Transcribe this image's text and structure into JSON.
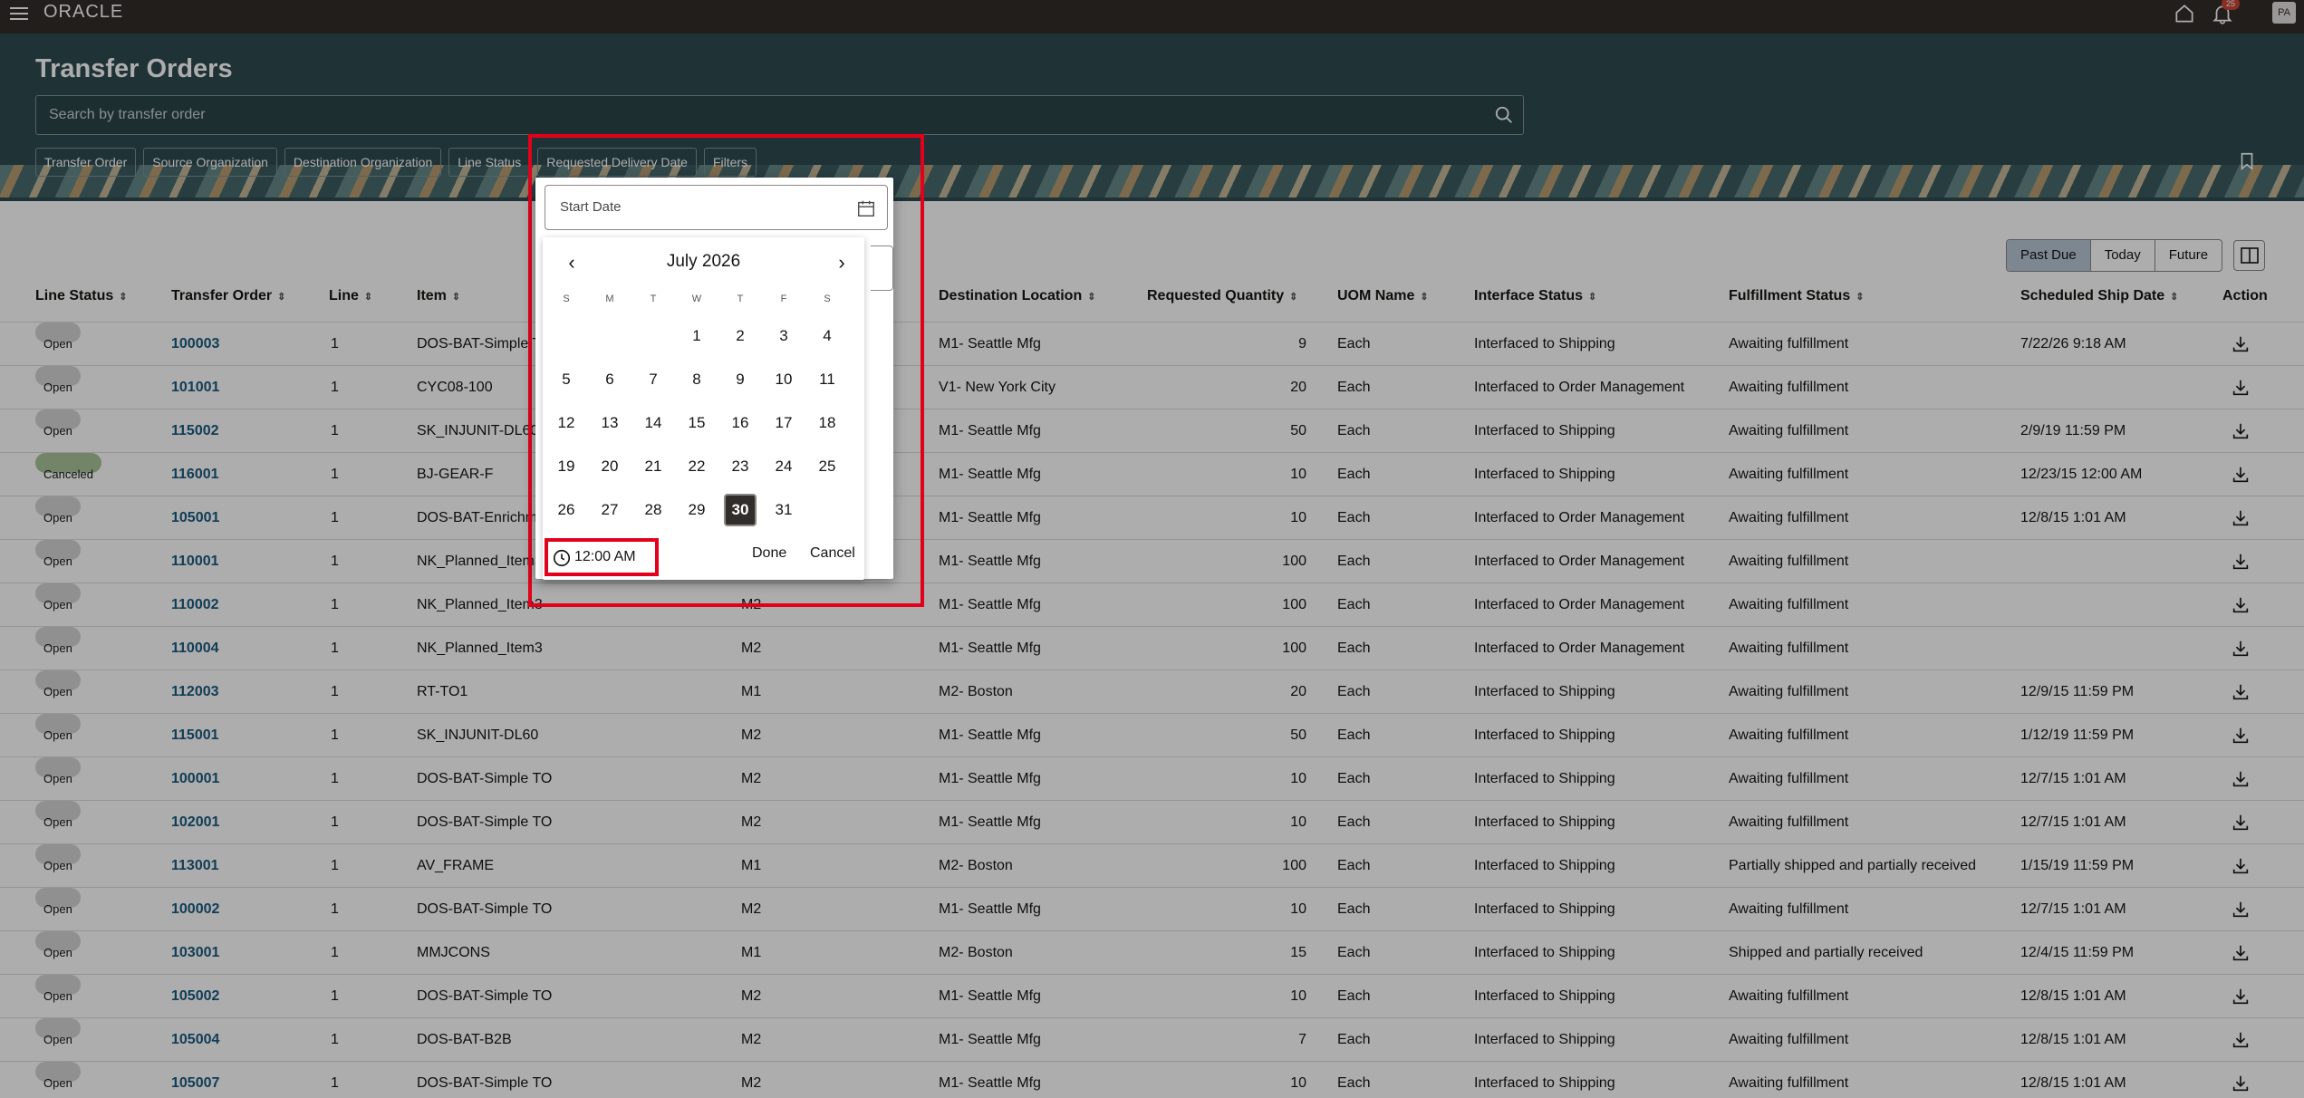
{
  "topbar": {
    "brand": "ORACLE",
    "notification_count": "25",
    "user_initials": "PA"
  },
  "header": {
    "title": "Transfer Orders",
    "search_placeholder": "Search by transfer order",
    "filter_chips": [
      "Transfer Order",
      "Source Organization",
      "Destination Organization",
      "Line Status",
      "Requested Delivery Date",
      "Filters"
    ]
  },
  "toolbar": {
    "segments": [
      "Past Due",
      "Today",
      "Future"
    ],
    "selected_segment": "Past Due"
  },
  "table": {
    "headers": {
      "line_status": "Line Status",
      "transfer_order": "Transfer Order",
      "line": "Line",
      "item": "Item",
      "destination_location": "Destination Location",
      "requested_quantity": "Requested Quantity",
      "uom_name": "UOM Name",
      "interface_status": "Interface Status",
      "fulfillment_status": "Fulfillment Status",
      "scheduled_ship_date": "Scheduled Ship Date",
      "action": "Action"
    },
    "rows": [
      {
        "status": "Open",
        "order": "100003",
        "line": "1",
        "item": "DOS-BAT-Simple TO",
        "org": "",
        "dest": "M1- Seattle Mfg",
        "qty": "9",
        "uom": "Each",
        "interface": "Interfaced to Shipping",
        "fulfillment": "Awaiting fulfillment",
        "ship": "7/22/26 9:18 AM"
      },
      {
        "status": "Open",
        "order": "101001",
        "line": "1",
        "item": "CYC08-100",
        "org": "",
        "dest": "V1- New York City",
        "qty": "20",
        "uom": "Each",
        "interface": "Interfaced to Order Management",
        "fulfillment": "Awaiting fulfillment",
        "ship": ""
      },
      {
        "status": "Open",
        "order": "115002",
        "line": "1",
        "item": "SK_INJUNIT-DL60",
        "org": "",
        "dest": "M1- Seattle Mfg",
        "qty": "50",
        "uom": "Each",
        "interface": "Interfaced to Shipping",
        "fulfillment": "Awaiting fulfillment",
        "ship": "2/9/19 11:59 PM"
      },
      {
        "status": "Canceled",
        "order": "116001",
        "line": "1",
        "item": "BJ-GEAR-F",
        "org": "",
        "dest": "M1- Seattle Mfg",
        "qty": "10",
        "uom": "Each",
        "interface": "Interfaced to Shipping",
        "fulfillment": "Awaiting fulfillment",
        "ship": "12/23/15 12:00 AM"
      },
      {
        "status": "Open",
        "order": "105001",
        "line": "1",
        "item": "DOS-BAT-Enrichment",
        "org": "",
        "dest": "M1- Seattle Mfg",
        "qty": "10",
        "uom": "Each",
        "interface": "Interfaced to Order Management",
        "fulfillment": "Awaiting fulfillment",
        "ship": "12/8/15 1:01 AM"
      },
      {
        "status": "Open",
        "order": "110001",
        "line": "1",
        "item": "NK_Planned_Item3",
        "org": "",
        "dest": "M1- Seattle Mfg",
        "qty": "100",
        "uom": "Each",
        "interface": "Interfaced to Order Management",
        "fulfillment": "Awaiting fulfillment",
        "ship": ""
      },
      {
        "status": "Open",
        "order": "110002",
        "line": "1",
        "item": "NK_Planned_Item3",
        "org": "M2",
        "dest": "M1- Seattle Mfg",
        "qty": "100",
        "uom": "Each",
        "interface": "Interfaced to Order Management",
        "fulfillment": "Awaiting fulfillment",
        "ship": ""
      },
      {
        "status": "Open",
        "order": "110004",
        "line": "1",
        "item": "NK_Planned_Item3",
        "org": "M2",
        "dest": "M1- Seattle Mfg",
        "qty": "100",
        "uom": "Each",
        "interface": "Interfaced to Order Management",
        "fulfillment": "Awaiting fulfillment",
        "ship": ""
      },
      {
        "status": "Open",
        "order": "112003",
        "line": "1",
        "item": "RT-TO1",
        "org": "M1",
        "dest": "M2- Boston",
        "qty": "20",
        "uom": "Each",
        "interface": "Interfaced to Shipping",
        "fulfillment": "Awaiting fulfillment",
        "ship": "12/9/15 11:59 PM"
      },
      {
        "status": "Open",
        "order": "115001",
        "line": "1",
        "item": "SK_INJUNIT-DL60",
        "org": "M2",
        "dest": "M1- Seattle Mfg",
        "qty": "50",
        "uom": "Each",
        "interface": "Interfaced to Shipping",
        "fulfillment": "Awaiting fulfillment",
        "ship": "1/12/19 11:59 PM"
      },
      {
        "status": "Open",
        "order": "100001",
        "line": "1",
        "item": "DOS-BAT-Simple TO",
        "org": "M2",
        "dest": "M1- Seattle Mfg",
        "qty": "10",
        "uom": "Each",
        "interface": "Interfaced to Shipping",
        "fulfillment": "Awaiting fulfillment",
        "ship": "12/7/15 1:01 AM"
      },
      {
        "status": "Open",
        "order": "102001",
        "line": "1",
        "item": "DOS-BAT-Simple TO",
        "org": "M2",
        "dest": "M1- Seattle Mfg",
        "qty": "10",
        "uom": "Each",
        "interface": "Interfaced to Shipping",
        "fulfillment": "Awaiting fulfillment",
        "ship": "12/7/15 1:01 AM"
      },
      {
        "status": "Open",
        "order": "113001",
        "line": "1",
        "item": "AV_FRAME",
        "org": "M1",
        "dest": "M2- Boston",
        "qty": "100",
        "uom": "Each",
        "interface": "Interfaced to Shipping",
        "fulfillment": "Partially shipped and partially received",
        "ship": "1/15/19 11:59 PM"
      },
      {
        "status": "Open",
        "order": "100002",
        "line": "1",
        "item": "DOS-BAT-Simple TO",
        "org": "M2",
        "dest": "M1- Seattle Mfg",
        "qty": "10",
        "uom": "Each",
        "interface": "Interfaced to Shipping",
        "fulfillment": "Awaiting fulfillment",
        "ship": "12/7/15 1:01 AM"
      },
      {
        "status": "Open",
        "order": "103001",
        "line": "1",
        "item": "MMJCONS",
        "org": "M1",
        "dest": "M2- Boston",
        "qty": "15",
        "uom": "Each",
        "interface": "Interfaced to Shipping",
        "fulfillment": "Shipped and partially received",
        "ship": "12/4/15 11:59 PM"
      },
      {
        "status": "Open",
        "order": "105002",
        "line": "1",
        "item": "DOS-BAT-Simple TO",
        "org": "M2",
        "dest": "M1- Seattle Mfg",
        "qty": "10",
        "uom": "Each",
        "interface": "Interfaced to Shipping",
        "fulfillment": "Awaiting fulfillment",
        "ship": "12/8/15 1:01 AM"
      },
      {
        "status": "Open",
        "order": "105004",
        "line": "1",
        "item": "DOS-BAT-B2B",
        "org": "M2",
        "dest": "M1- Seattle Mfg",
        "qty": "7",
        "uom": "Each",
        "interface": "Interfaced to Shipping",
        "fulfillment": "Awaiting fulfillment",
        "ship": "12/8/15 1:01 AM"
      },
      {
        "status": "Open",
        "order": "105007",
        "line": "1",
        "item": "DOS-BAT-Simple TO",
        "org": "M2",
        "dest": "M1- Seattle Mfg",
        "qty": "10",
        "uom": "Each",
        "interface": "Interfaced to Shipping",
        "fulfillment": "Awaiting fulfillment",
        "ship": "12/8/15 1:01 AM"
      }
    ]
  },
  "datepicker": {
    "start_label": "Start Date",
    "month_label": "July 2026",
    "weekdays": [
      "S",
      "M",
      "T",
      "W",
      "T",
      "F",
      "S"
    ],
    "first_weekday_index": 3,
    "days_in_month": 31,
    "selected_day": 30,
    "time": "12:00 AM",
    "done_label": "Done",
    "cancel_label": "Cancel",
    "highlight_color": "#e3001b"
  },
  "colors": {
    "topbar": "#312d2a",
    "banner": "#2e4a50",
    "link": "#1a5a80",
    "canceled_badge": "#a9c59a"
  }
}
